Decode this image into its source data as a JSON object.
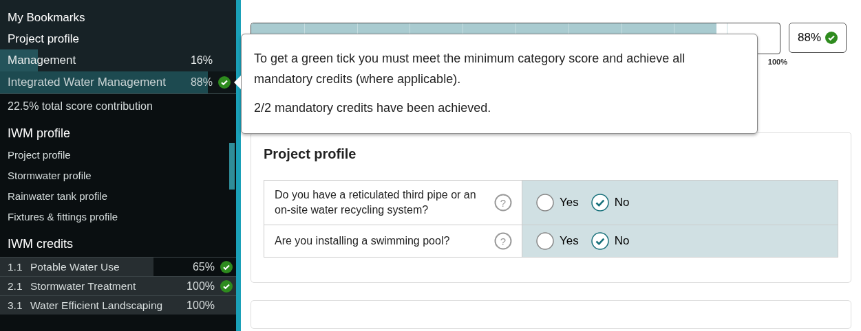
{
  "sidebar": {
    "top_links": [
      "My Bookmarks",
      "Project profile"
    ],
    "categories": [
      {
        "label": "Management",
        "score": "16%",
        "level": 0.16,
        "tick": false,
        "selected": false
      },
      {
        "label": "Integrated Water Management",
        "score": "88%",
        "level": 0.88,
        "tick": true,
        "selected": true
      }
    ],
    "contribution": "22.5% total score contribution",
    "profile_heading": "IWM profile",
    "profile_items": [
      "Project profile",
      "Stormwater profile",
      "Rainwater tank profile",
      "Fixtures & fittings profile"
    ],
    "credits_heading": "IWM credits",
    "credits": [
      {
        "number": "1.1",
        "label": "Potable Water Use",
        "score": "65%",
        "level": 0.65,
        "tick": true
      },
      {
        "number": "2.1",
        "label": "Stormwater Treatment",
        "score": "100%",
        "level": 1,
        "tick": true
      },
      {
        "number": "3.1",
        "label": "Water Efficient Landscaping",
        "score": "100%",
        "level": 1,
        "tick": false
      }
    ]
  },
  "score_bar": {
    "level": 0.88,
    "end_label": "100%",
    "score": "88%",
    "tick": true
  },
  "tooltip": {
    "paragraphs": [
      "To get a green tick you must meet the minimum category score and achieve all mandatory credits (where applicable).",
      "2/2 mandatory credits have been achieved."
    ]
  },
  "card": {
    "title": "Project profile",
    "help_glyph": "?",
    "questions": [
      {
        "text": "Do you have a reticulated third pipe or an on-site water recycling system?",
        "options": [
          {
            "label": "Yes",
            "selected": false
          },
          {
            "label": "No",
            "selected": true
          }
        ]
      },
      {
        "text": "Are you installing a swimming pool?",
        "options": [
          {
            "label": "Yes",
            "selected": false
          },
          {
            "label": "No",
            "selected": true
          }
        ]
      }
    ]
  }
}
